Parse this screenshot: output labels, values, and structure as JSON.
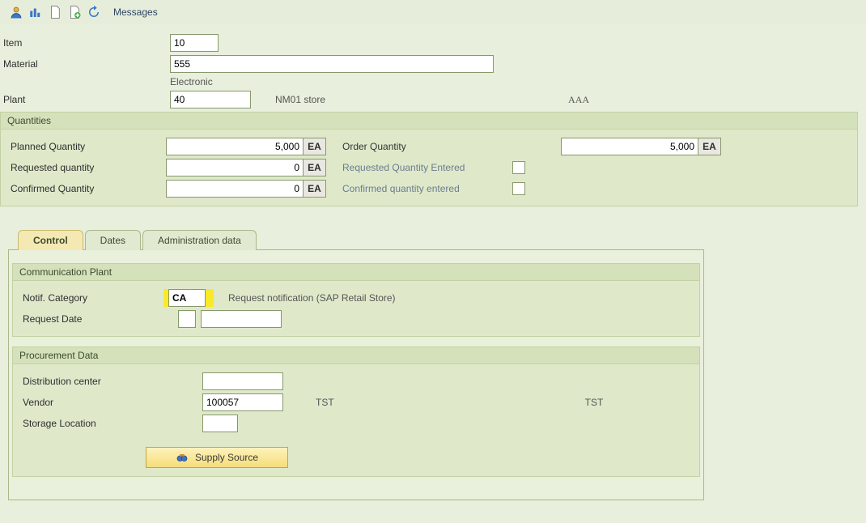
{
  "toolbar": {
    "messages_label": "Messages"
  },
  "header": {
    "item_label": "Item",
    "item_value": "10",
    "material_label": "Material",
    "material_value": "555",
    "material_desc": "Electronic",
    "plant_label": "Plant",
    "plant_value": "40",
    "plant_name": "NM01 store",
    "plant_extra": "AAA"
  },
  "quantities": {
    "title": "Quantities",
    "planned_label": "Planned Quantity",
    "planned_value": "5,000",
    "planned_unit": "EA",
    "order_label": "Order Quantity",
    "order_value": "5,000",
    "order_unit": "EA",
    "requested_label": "Requested quantity",
    "requested_value": "0",
    "requested_unit": "EA",
    "requested_entered_label": "Requested Quantity Entered",
    "confirmed_label": "Confirmed Quantity",
    "confirmed_value": "0",
    "confirmed_unit": "EA",
    "confirmed_entered_label": "Confirmed quantity entered"
  },
  "tabs": {
    "control": "Control",
    "dates": "Dates",
    "admin": "Administration data"
  },
  "comm_plant": {
    "title": "Communication Plant",
    "notif_cat_label": "Notif. Category",
    "notif_cat_value": "CA",
    "notif_cat_desc": "Request notification   (SAP Retail Store)",
    "request_date_label": "Request Date",
    "request_date_value1": "",
    "request_date_value2": ""
  },
  "proc": {
    "title": "Procurement Data",
    "dc_label": "Distribution center",
    "dc_value": "",
    "vendor_label": "Vendor",
    "vendor_value": "100057",
    "vendor_name1": "TST",
    "vendor_name2": "TST",
    "storage_label": "Storage Location",
    "storage_value": "",
    "supply_btn": "Supply Source"
  }
}
